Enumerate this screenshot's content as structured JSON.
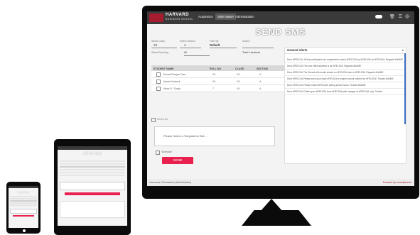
{
  "app": {
    "brand": "HARVARD",
    "brand_sub": "BUSINESS SCHOOL",
    "nav": [
      "Academics",
      "SMS Master",
      "Administration"
    ],
    "active_nav": "SMS Master",
    "page_title": "SEND SMS"
  },
  "filters": {
    "select_class_label": "Select Class",
    "select_class_value": "XII",
    "select_section_label": "Select Section",
    "select_section_value": "A",
    "filter_by_label": "Filter By",
    "filter_by_value": "Default",
    "search_label": "Search",
    "select_boarding_label": "Select Boarding",
    "boarding_value": "All",
    "total_students": "Total 0 students"
  },
  "table": {
    "headers": [
      "STUDENT NAME",
      "ROLL NO",
      "CLASS",
      "SECTION"
    ],
    "rows": [
      [
        "Sahrat Ranjan Das",
        "09",
        "XII",
        "A"
      ],
      [
        "Uporie Nodent",
        "09",
        "XII",
        "A"
      ],
      [
        "Utsav S. Singh",
        "7",
        "XII",
        "A"
      ]
    ]
  },
  "compose": {
    "select_all": "Select All",
    "template_placeholder": "Please Select a Template to Edit...",
    "schedule": "Schedule",
    "send_label": "SEND"
  },
  "alerts": {
    "heading": "General Alerts",
    "items": [
      "Dear #FIELD1#, All the participants are requested to reach #FIELD2# by #FIELD3# on #FIELD4#. Regards #NAME",
      "Dear #FIELD1# The new office address is as #FIELD2#. Regards #NAME",
      "Dear #FIELD1# The School will remain closed on #FIELD2# due to #FIELD3#. Regards #NAME",
      "Dear #FIELD1# Please send your ward #FIELD2# in proper school uniform for #FIELD3#. Thanks #NAME",
      "Dear #FIELD1# Please collect #FIELD2# during school hours. Thanks #NAME",
      "Dear #FIELD1# Collect your #FIELD2# from #FIELD3# with charges of #FIELD4# only. Thanks"
    ]
  },
  "footer": {
    "user": "Username: Demoadmin (Administrator)",
    "powered": "Powered by sosss@zerole"
  },
  "colors": {
    "accent": "#e8214f",
    "brand": "#a51c30",
    "topbar": "#3a3a3a"
  }
}
